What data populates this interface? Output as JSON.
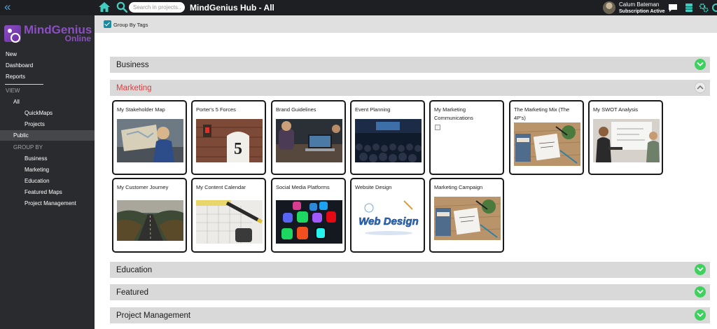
{
  "header": {
    "title": "MindGenius Hub - All",
    "search_placeholder": "Search in projects...",
    "user": {
      "name": "Calum Bateman",
      "status": "Subscription Active"
    }
  },
  "logo": {
    "name": "MindGenius",
    "sub": "Online"
  },
  "sidebar": {
    "top_items": [
      "New",
      "Dashboard",
      "Reports"
    ],
    "view_label": "VIEW",
    "view_all": "All",
    "view_subitems": [
      "QuickMaps",
      "Projects"
    ],
    "public": "Public",
    "group_by_label": "GROUP BY",
    "group_items": [
      "Business",
      "Marketing",
      "Education",
      "Featured Maps",
      "Project Management"
    ]
  },
  "filter": {
    "group_by_tags_label": "Group By Tags",
    "group_by_tags_checked": true
  },
  "groups": [
    {
      "name": "Business",
      "expanded": false
    },
    {
      "name": "Marketing",
      "expanded": true
    },
    {
      "name": "Education",
      "expanded": false
    },
    {
      "name": "Featured",
      "expanded": false
    },
    {
      "name": "Project Management",
      "expanded": false
    }
  ],
  "marketing_cards": [
    {
      "title": "My Stakeholder Map",
      "image": "map-photo"
    },
    {
      "title": "Porter's 5 Forces",
      "image": "number-five-photo"
    },
    {
      "title": "Brand Guidelines",
      "image": "laptop-meeting-photo"
    },
    {
      "title": "Event Planning",
      "image": "audience-photo"
    },
    {
      "title": "My Marketing Communications",
      "image": "broken-image"
    },
    {
      "title": "The Marketing Mix (The 4P's)",
      "image": "desk-notebook-photo"
    },
    {
      "title": "My SWOT Analysis",
      "image": "whiteboard-meeting-photo"
    },
    {
      "title": "My Customer Journey",
      "image": "road-photo"
    },
    {
      "title": "My Content Calendar",
      "image": "calendar-photo"
    },
    {
      "title": "Social Media Platforms",
      "image": "social-icons-photo"
    },
    {
      "title": "Website Design",
      "image": "web-design-graphic",
      "image_text": "Web Design"
    },
    {
      "title": "Marketing Campaign",
      "image": "desk-notebook-photo"
    }
  ],
  "colors": {
    "topbar": "#1e1f22",
    "sidebar": "#2a2b2e",
    "accent_teal": "#1a8aa0",
    "active_group": "#e23b3b",
    "toggle_green": "#3fd160",
    "logo_purple": "#8a4fc1"
  }
}
